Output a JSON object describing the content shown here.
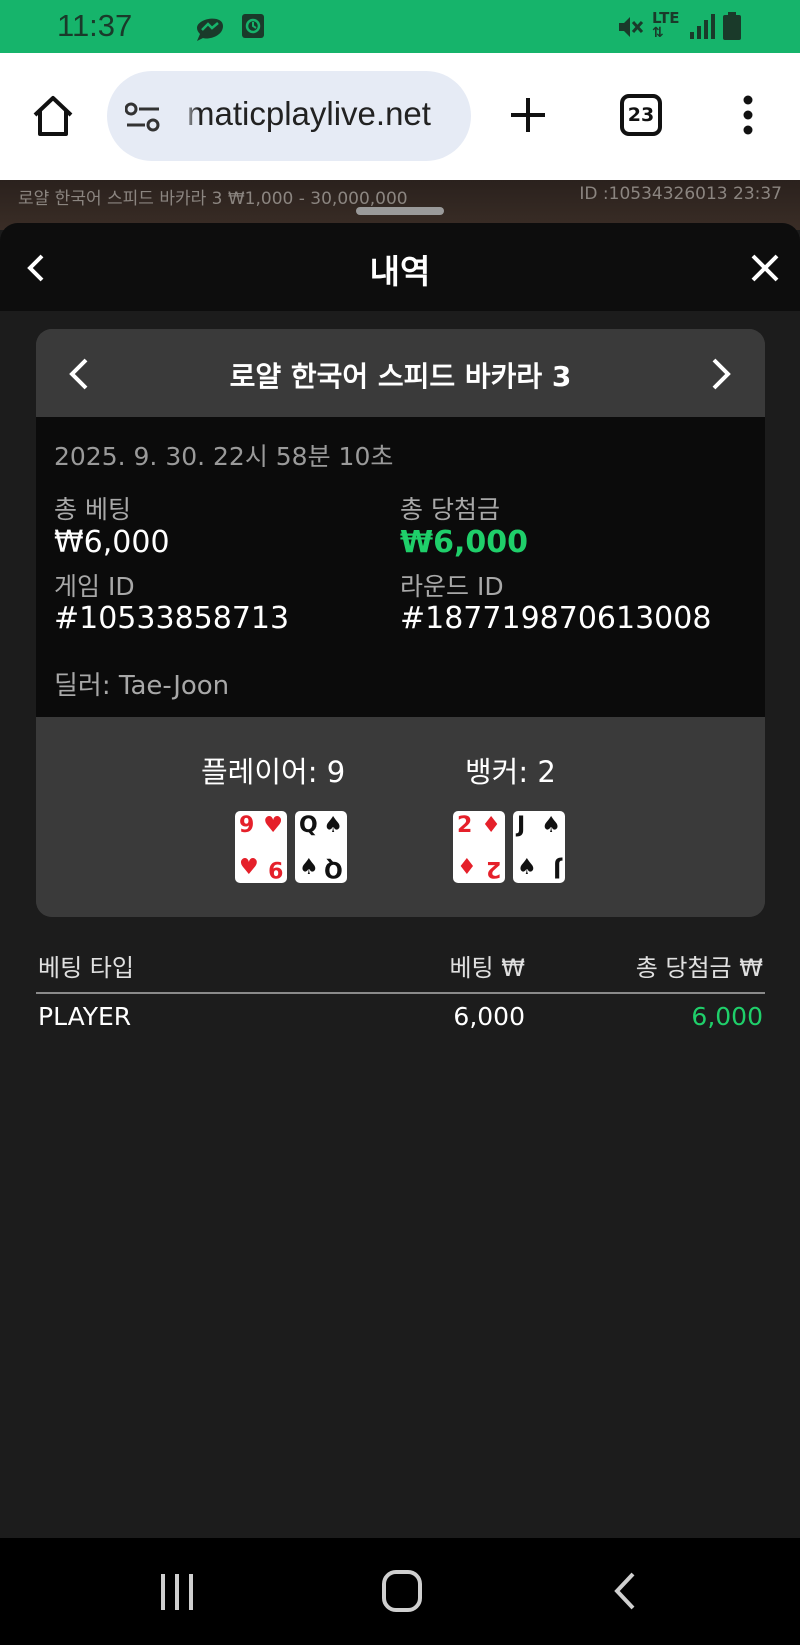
{
  "status_bar": {
    "time": "11:37",
    "left_icons": [
      "messenger-icon",
      "screen-record-icon"
    ],
    "right_icons": [
      "mute-icon",
      "lte-icon",
      "signal-icon",
      "battery-icon"
    ],
    "network_label": "LTE"
  },
  "browser": {
    "url": "pragmaticplaylive.net",
    "url_visible": "maticplaylive.net",
    "tab_count": "23",
    "icons": [
      "home-icon",
      "site-settings-icon",
      "new-tab-icon",
      "tabs-icon",
      "menu-icon"
    ]
  },
  "game_strip": {
    "left_text": "로얄 한국어 스피드 바카라 3 ₩1,000 - 30,000,000",
    "right_text": "ID :10534326013 23:37"
  },
  "sheet": {
    "title": "내역",
    "back_icon": "chevron-left-icon",
    "close_icon": "close-icon"
  },
  "round": {
    "game_name": "로얄 한국어 스피드 바카라 3",
    "datetime": "2025. 9. 30. 22시 58분 10초",
    "total_bet_label": "총 베팅",
    "total_bet_value": "₩6,000",
    "total_win_label": "총 당첨금",
    "total_win_value": "₩6,000",
    "game_id_label": "게임 ID",
    "game_id_value": "#10533858713",
    "round_id_label": "라운드 ID",
    "round_id_value": "#187719870613008",
    "dealer": "딜러: Tae-Joon",
    "player_label": "플레이어: 9",
    "banker_label": "뱅커: 2",
    "player_cards": [
      {
        "rank": "9",
        "suit": "♥",
        "color": "red"
      },
      {
        "rank": "Q",
        "suit": "♠",
        "color": "black"
      }
    ],
    "banker_cards": [
      {
        "rank": "2",
        "suit": "♦",
        "color": "red"
      },
      {
        "rank": "J",
        "suit": "♠",
        "color": "black"
      }
    ]
  },
  "bets_table": {
    "headers": [
      "베팅 타입",
      "베팅 ₩",
      "총 당첨금 ₩"
    ],
    "rows": [
      {
        "type": "PLAYER",
        "bet": "6,000",
        "win": "6,000"
      }
    ]
  },
  "colors": {
    "status_bar": "#16b46b",
    "win_green": "#1fcf6a",
    "card_red": "#e5202a"
  },
  "nav_bar": {
    "icons": [
      "recent-apps-icon",
      "home-nav-icon",
      "back-nav-icon"
    ]
  }
}
